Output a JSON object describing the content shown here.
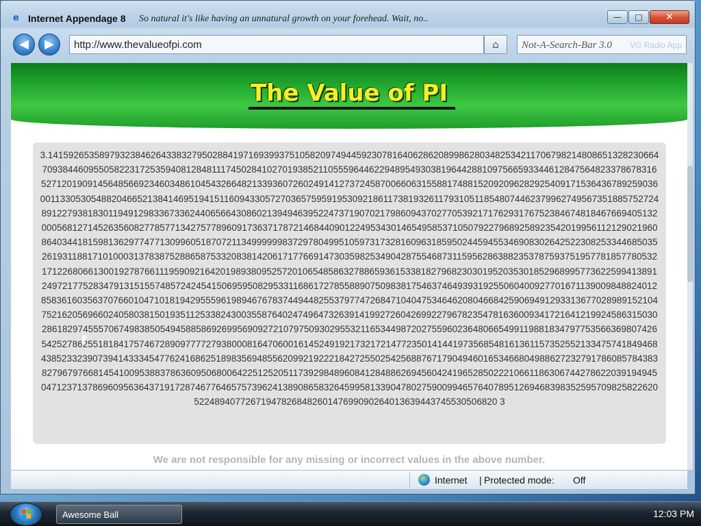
{
  "window": {
    "title": "Internet Appendage 8",
    "subtitle": "So natural it's like having an unnatural growth on your forehead.  Wait, no..",
    "minimize_glyph": "—",
    "maximize_glyph": "□",
    "close_glyph": "✕"
  },
  "nav": {
    "back_glyph": "◀",
    "forward_glyph": "▶",
    "address": "http://www.thevalueofpi.com",
    "home_glyph": "⌂",
    "search_text": "Not-A-Search-Bar 3.0",
    "search_ghost_text": "VG Radio App"
  },
  "page": {
    "banner_title": "The Value of PI",
    "pi_digits": "3.14159265358979323846264338327950288419716939937510582097494459230781640628620899862803482534211706798214808651328230664709384460955058223172535940812848111745028410270193852110555964462294895493038196442881097566593344612847564823378678316527120190914564856692346034861045432664821339360726024914127372458700660631558817488152092096282925409171536436789259036001133053054882046652138414695194151160943305727036575959195309218611738193261179310511854807446237996274956735188575272489122793818301194912983367336244065664308602139494639522473719070217986094370277053921717629317675238467481846766940513200056812714526356082778577134275778960917363717872146844090122495343014654958537105079227968925892354201995611212902196086403441815981362977477130996051870721134999999837297804995105973173281609631859502445945534690830264252230825334468503526193118817101000313783875288658753320838142061717766914730359825349042875546873115956286388235378759375195778185778053217122680661300192787661119590921642019893809525720106548586327886593615338182796823030195203530185296899577362259941389124972177528347913151557485724245415069595082953311686172785588907509838175463746493931925506040092770167113900984882401285836160356370766010471018194295559619894676783744944825537977472684710404753464620804668425906949129331367702898915210475216205696602405803815019351125338243003558764024749647326391419927260426992279678235478163600934172164121992458631503028618297455570674983850549458858692699569092721079750930295532116534498720275596023648066549911988183479775356636980742654252786255181841757467289097777279380008164706001614524919217321721477235014144197356854816136115735255213347574184946843852332390739414333454776241686251898356948556209921922218427255025425688767179049460165346680498862723279178608578438382796797668145410095388378636095068006422512520511739298489608412848862694560424196528502221066118630674427862203919494504712371378696095636437191728746776465757396241389086583264599581339047802759009946576407895126946839835259570982582262052248940772671947826848260147699090264013639443745530506820 3",
    "disclaimer": "We are not responsible for any missing or incorrect values in the above number."
  },
  "status": {
    "zone": "Internet",
    "separator": "|",
    "protected_label": "Protected mode:",
    "protected_value": "Off"
  },
  "taskbar": {
    "task_label": "Awesome Ball",
    "clock": "12:03 PM"
  }
}
